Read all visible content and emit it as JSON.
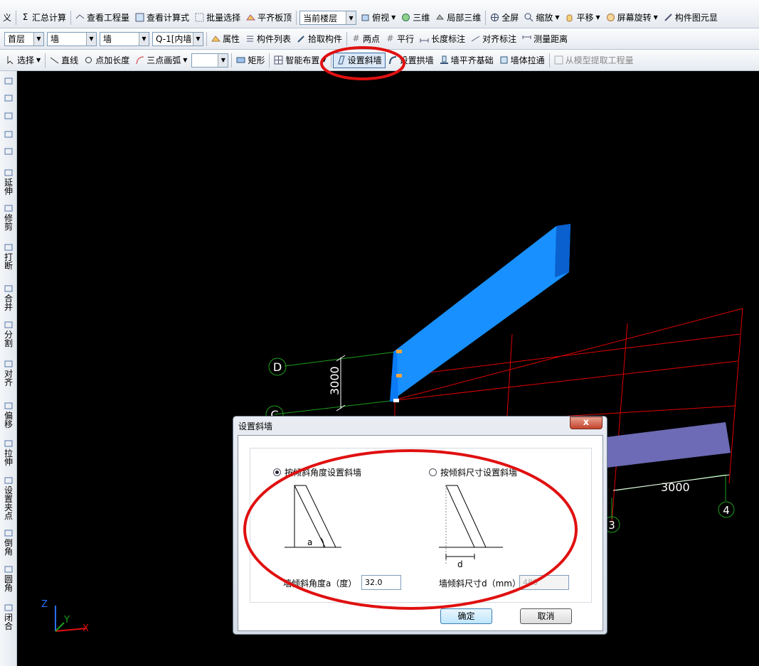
{
  "toolbar1": {
    "partial_left": "义",
    "sum_calc": "汇总计算",
    "view_qty": "查看工程量",
    "view_formula": "查看计算式",
    "batch_select": "批量选择",
    "align_slab": "平齐板顶",
    "floor_select": "当前楼层",
    "top_view": "俯视",
    "three_d": "三维",
    "local_3d": "局部三维",
    "full_screen": "全屏",
    "zoom": "缩放",
    "pan": "平移",
    "rotate_screen": "屏幕旋转",
    "component_display": "构件图元显"
  },
  "toolbar2": {
    "floor": "首层",
    "category": "墙",
    "type": "墙",
    "component": "Q-1[内墙",
    "properties": "属性",
    "component_list": "构件列表",
    "pick_component": "拾取构件",
    "two_points": "两点",
    "parallel": "平行",
    "length_mark": "长度标注",
    "align_mark": "对齐标注",
    "measure_distance": "测量距离"
  },
  "toolbar3": {
    "select": "选择",
    "line": "直线",
    "point_length": "点加长度",
    "three_point_arc": "三点画弧",
    "rectangle": "矩形",
    "smart_layout": "智能布置",
    "set_slant_wall": "设置斜墙",
    "set_arch_wall": "设置拱墙",
    "wall_align_foundation": "墙平齐基础",
    "wall_stretch": "墙体拉通",
    "extract_from_model": "从模型提取工程量"
  },
  "left_toolbar": [
    {
      "label": "",
      "icon": "brush-icon"
    },
    {
      "label": "",
      "icon": "copy-icon"
    },
    {
      "label": "",
      "icon": "mirror-icon"
    },
    {
      "label": "",
      "icon": "move-icon"
    },
    {
      "label": "",
      "icon": "rotate-icon"
    },
    {
      "label": "延伸",
      "icon": "extend-icon"
    },
    {
      "label": "修剪",
      "icon": "trim-icon"
    },
    {
      "label": "打断",
      "icon": "break-icon"
    },
    {
      "label": "合并",
      "icon": "merge-icon"
    },
    {
      "label": "分割",
      "icon": "split-icon"
    },
    {
      "label": "对齐",
      "icon": "align-icon"
    },
    {
      "label": "偏移",
      "icon": "offset-icon"
    },
    {
      "label": "拉伸",
      "icon": "stretch-icon"
    },
    {
      "label": "设置夹点",
      "icon": "grip-icon"
    },
    {
      "label": "倒角",
      "icon": "chamfer-icon"
    },
    {
      "label": "圆角",
      "icon": "fillet-icon"
    },
    {
      "label": "闭合",
      "icon": "close-shape-icon"
    }
  ],
  "canvas": {
    "axis_labels": {
      "d": "D",
      "c": "C",
      "three": "3",
      "four": "4"
    },
    "dims": {
      "vertical": "3000",
      "horizontal": "3000"
    },
    "axis_tri": {
      "z": "Z",
      "y": "Y",
      "x": "X"
    }
  },
  "dialog": {
    "title": "设置斜墙",
    "close": "x",
    "option_angle": "按倾斜角度设置斜墙",
    "option_size": "按倾斜尺寸设置斜墙",
    "diagram_angle_label": "a",
    "diagram_size_label": "d",
    "angle_label": "墙倾斜角度a（度）",
    "angle_value": "32.0",
    "size_label": "墙倾斜尺寸d（mm）",
    "size_value": "480",
    "ok": "确定",
    "cancel": "取消"
  },
  "colors": {
    "wall_blue": "#0a7af5",
    "grid_red": "#e00000",
    "axis_green": "#1e9e1e",
    "annotation_red": "#e01010"
  }
}
